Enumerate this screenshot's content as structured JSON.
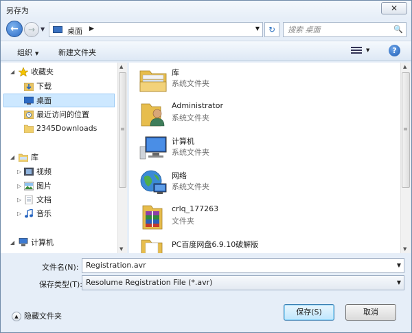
{
  "window": {
    "title": "另存为",
    "close_glyph": "✕"
  },
  "navbar": {
    "back_glyph": "←",
    "forward_glyph": "→",
    "history_glyph": "▼",
    "address_crumb": "桌面",
    "crumb_arrow": "▶",
    "address_dropdown_glyph": "▼",
    "refresh_glyph": "↻",
    "search_placeholder": "搜索 桌面",
    "search_glyph": "🔍"
  },
  "toolbar": {
    "organize_label": "组织",
    "organize_caret": "▼",
    "new_folder_label": "新建文件夹",
    "view_caret": "▼",
    "help_glyph": "?"
  },
  "sidebar": {
    "items": [
      {
        "label": "收藏夹",
        "icon": "star-icon",
        "arrow": "◢"
      },
      {
        "label": "下载",
        "icon": "downloads-folder-icon"
      },
      {
        "label": "桌面",
        "icon": "desktop-icon",
        "selected": true
      },
      {
        "label": "最近访问的位置",
        "icon": "recent-places-icon"
      },
      {
        "label": "2345Downloads",
        "icon": "folder-icon"
      },
      {
        "label": "库",
        "icon": "libraries-icon",
        "arrow": "◢"
      },
      {
        "label": "视频",
        "icon": "videos-icon",
        "arrow": "▷"
      },
      {
        "label": "图片",
        "icon": "pictures-icon",
        "arrow": "▷"
      },
      {
        "label": "文档",
        "icon": "documents-icon",
        "arrow": "▷"
      },
      {
        "label": "音乐",
        "icon": "music-icon",
        "arrow": "▷"
      },
      {
        "label": "计算机",
        "icon": "computer-icon",
        "arrow": "◢"
      }
    ]
  },
  "files": [
    {
      "name": "库",
      "type": "系统文件夹",
      "icon": "libraries-icon"
    },
    {
      "name": "Administrator",
      "type": "系统文件夹",
      "icon": "user-folder-icon"
    },
    {
      "name": "计算机",
      "type": "系统文件夹",
      "icon": "computer-icon"
    },
    {
      "name": "网络",
      "type": "系统文件夹",
      "icon": "network-icon"
    },
    {
      "name": "crlq_177263",
      "type": "文件夹",
      "icon": "archive-folder-icon"
    },
    {
      "name": "PC百度网盘6.9.10破解版",
      "type": "",
      "icon": "folder-icon"
    }
  ],
  "form": {
    "filename_label": "文件名(N):",
    "filename_value": "Registration.avr",
    "filetype_label": "保存类型(T):",
    "filetype_value": "Resolume Registration File (*.avr)",
    "dropdown_glyph": "▼"
  },
  "footer": {
    "hide_folders_label": "隐藏文件夹",
    "hide_folders_glyph": "▲",
    "save_label": "保存(S)",
    "cancel_label": "取消"
  },
  "scrollbar": {
    "up_glyph": "▲",
    "down_glyph": "▼",
    "grip_glyph": "≡"
  }
}
